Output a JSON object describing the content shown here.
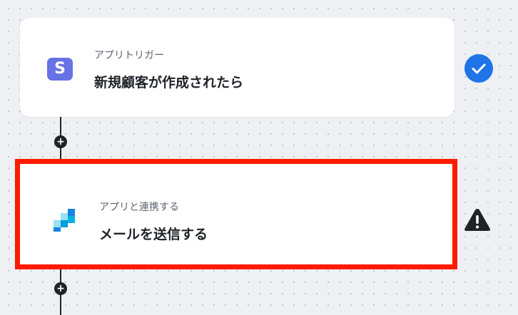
{
  "flow": {
    "steps": [
      {
        "label": "アプリトリガー",
        "title": "新規顧客が作成されたら",
        "icon": "stripe-s-icon",
        "icon_letter": "S",
        "status": "check-icon"
      },
      {
        "label": "アプリと連携する",
        "title": "メールを送信する",
        "icon": "sendgrid-mosaic-icon",
        "status": "warning-icon"
      }
    ],
    "add_node_symbol": "+"
  },
  "colors": {
    "canvas": "#eef0f4",
    "highlight_border": "#ff1a00",
    "check_badge": "#1f74e8",
    "stripe_purple": "#6772e5",
    "connector": "#1f2328"
  }
}
